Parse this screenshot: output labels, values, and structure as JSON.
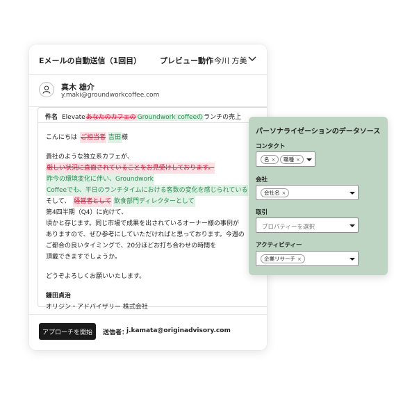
{
  "header": {
    "title": "Eメールの自動送信（1回目）",
    "preview_label": "プレビュー動作",
    "preview_user": "今川 方美"
  },
  "sender": {
    "name": "真木 雄介",
    "email": "y.maki@groundworkcoffee.com"
  },
  "email": {
    "subject_label": "件名",
    "subject_prefix": "Elevate",
    "subject_deleted": "あなたのカフェの",
    "subject_inserted": "Groundwork coffeeの",
    "subject_suffix": "ランチの売上",
    "greeting_prefix": "こんにちは",
    "greeting_deleted": "ご担当者",
    "greeting_inserted": "吉田",
    "greeting_suffix": "様",
    "p1_line1": "貴社のような独立系カフェが、",
    "p1_deleted": "厳しい状況に直面されていることをお見受けしております。",
    "p1_inserted_1": "昨今の環境変化に伴い、Groundwork",
    "p1_inserted_2": "Coffeeでも、平日のランチタイムにおける客数の変化を感じられている",
    "p2_prefix": "そして、",
    "p2_deleted": "経営者として",
    "p2_inserted": "飲食部門ディレクターとして",
    "p2_line2": "第4四半期（Q4）に向けて、",
    "p3_line1": "頃かと存じます。同じ市場で成果を出されているオーナー様の事例が",
    "p3_line2": "ありますので、ぜひ参考にしていただければと思っております。今週の",
    "p3_line3": "ご都合の良いタイミングで、20分ほどお打ち合わせの時間を",
    "p3_line4": "頂戴できますでしょうか。",
    "closing": "どうぞよろしくお願いいたします。",
    "sig_name": "鎌田貞治",
    "sig_company": "オリジン・アドバイザリー 株式会社"
  },
  "footer": {
    "approach_button": "アプローチを開始",
    "sender_label": "送信者：",
    "sender_address": "j.kamata@originadvisory.com"
  },
  "panel": {
    "title": "パーソナライゼーションのデータソース",
    "contact_label": "コンタクト",
    "contact_chips": [
      "名",
      "職種"
    ],
    "company_label": "会社",
    "company_chips": [
      "会社名"
    ],
    "deal_label": "取引",
    "deal_placeholder": "プロパティーを選択",
    "activity_label": "アクティビティー",
    "activity_chips": [
      "企業リサーチ"
    ]
  },
  "colors": {
    "deleted_bg": "#fde0e4",
    "deleted_text": "#d21a3c",
    "inserted_bg": "#dff2e5",
    "inserted_text": "#2c8a52",
    "panel_bg": "#bfd5c3",
    "button_bg": "#1a1a1a"
  },
  "icons": {
    "avatar": "person-icon",
    "chevron": "chevron-down-icon",
    "chip_remove": "close-icon",
    "dropdown": "caret-down-icon"
  }
}
